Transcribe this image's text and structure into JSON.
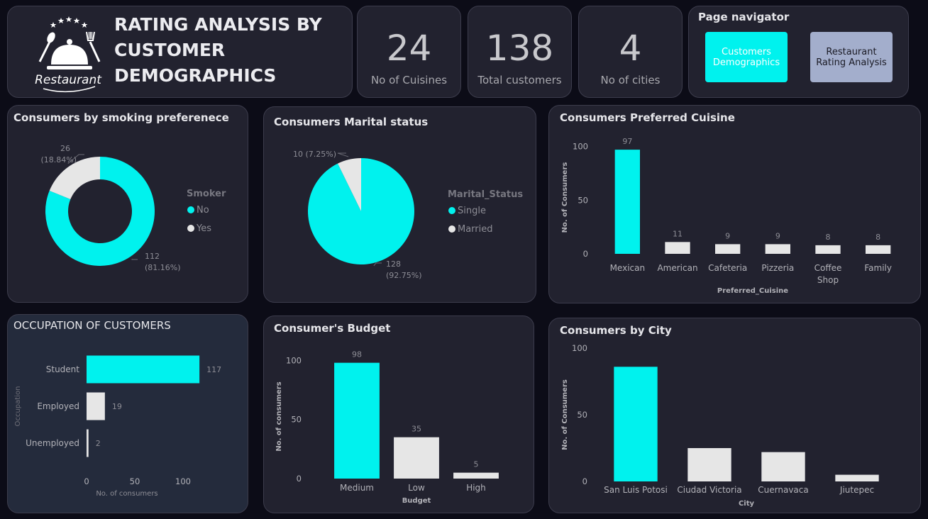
{
  "header": {
    "logo_text": "Restaurant",
    "title": "RATING ANALYSIS BY CUSTOMER DEMOGRAPHICS"
  },
  "kpis": [
    {
      "value": "24",
      "label": "No of Cuisines"
    },
    {
      "value": "138",
      "label": "Total customers"
    },
    {
      "value": "4",
      "label": "No of cities"
    }
  ],
  "navigator": {
    "title": "Page navigator",
    "buttons": [
      {
        "label": "Customers Demographics",
        "active": true
      },
      {
        "label": "Restaurant Rating Analysis",
        "active": false
      }
    ]
  },
  "colors": {
    "primary": "#00f2ee",
    "secondary": "#e6e6e6",
    "background": "#0c0c17",
    "card": "#22222f",
    "nav_inactive": "#a3aecc"
  },
  "chart_data": [
    {
      "id": "smoking",
      "type": "donut",
      "title": "Consumers by smoking preferenece",
      "legend_title": "Smoker",
      "legend_position": "right",
      "slices": [
        {
          "name": "No",
          "value": 112,
          "label": "112",
          "percent": "(81.16%)",
          "color": "#00f2ee"
        },
        {
          "name": "Yes",
          "value": 26,
          "label": "26",
          "percent": "(18.84%)",
          "color": "#e6e6e6"
        }
      ]
    },
    {
      "id": "marital",
      "type": "pie",
      "title": "Consumers Marital status",
      "legend_title": "Marital_Status",
      "legend_position": "right",
      "slices": [
        {
          "name": "Single",
          "value": 128,
          "label": "128",
          "percent": "(92.75%)",
          "color": "#00f2ee"
        },
        {
          "name": "Married",
          "value": 10,
          "label": "10 (7.25%)",
          "percent": "",
          "color": "#e6e6e6"
        }
      ]
    },
    {
      "id": "cuisine",
      "type": "bar",
      "title": "Consumers Preferred Cuisine",
      "categories": [
        "Mexican",
        "American",
        "Cafeteria",
        "Pizzeria",
        "Coffee Shop",
        "Family"
      ],
      "values": [
        97,
        11,
        9,
        9,
        8,
        8
      ],
      "xlabel": "Preferred_Cuisine",
      "ylabel": "No. of Consumers",
      "ylim": [
        0,
        105
      ],
      "yticks": [
        0,
        50,
        100
      ],
      "data_labels": true,
      "grid": false
    },
    {
      "id": "occupation",
      "type": "bar",
      "orientation": "horizontal",
      "title": "OCCUPATION OF CUSTOMERS",
      "categories": [
        "Student",
        "Employed",
        "Unemployed"
      ],
      "values": [
        117,
        19,
        2
      ],
      "xlabel": "No. of consumers",
      "ylabel": "Occupation",
      "xlim": [
        0,
        125
      ],
      "xticks": [
        0,
        50,
        100
      ],
      "data_labels": true,
      "grid": false
    },
    {
      "id": "budget",
      "type": "bar",
      "title": "Consumer's Budget",
      "categories": [
        "Medium",
        "Low",
        "High"
      ],
      "values": [
        98,
        35,
        5
      ],
      "xlabel": "Budget",
      "ylabel": "No. of consumers",
      "ylim": [
        0,
        105
      ],
      "yticks": [
        0,
        50,
        100
      ],
      "data_labels": true,
      "grid": false
    },
    {
      "id": "city",
      "type": "bar",
      "title": "Consumers by City",
      "categories": [
        "San Luis Potosi",
        "Ciudad Victoria",
        "Cuernavaca",
        "Jiutepec"
      ],
      "values": [
        86,
        25,
        22,
        5
      ],
      "xlabel": "City",
      "ylabel": "No. of Consumers",
      "ylim": [
        0,
        100
      ],
      "yticks": [
        0,
        50,
        100
      ],
      "data_labels": false,
      "grid": false
    }
  ]
}
